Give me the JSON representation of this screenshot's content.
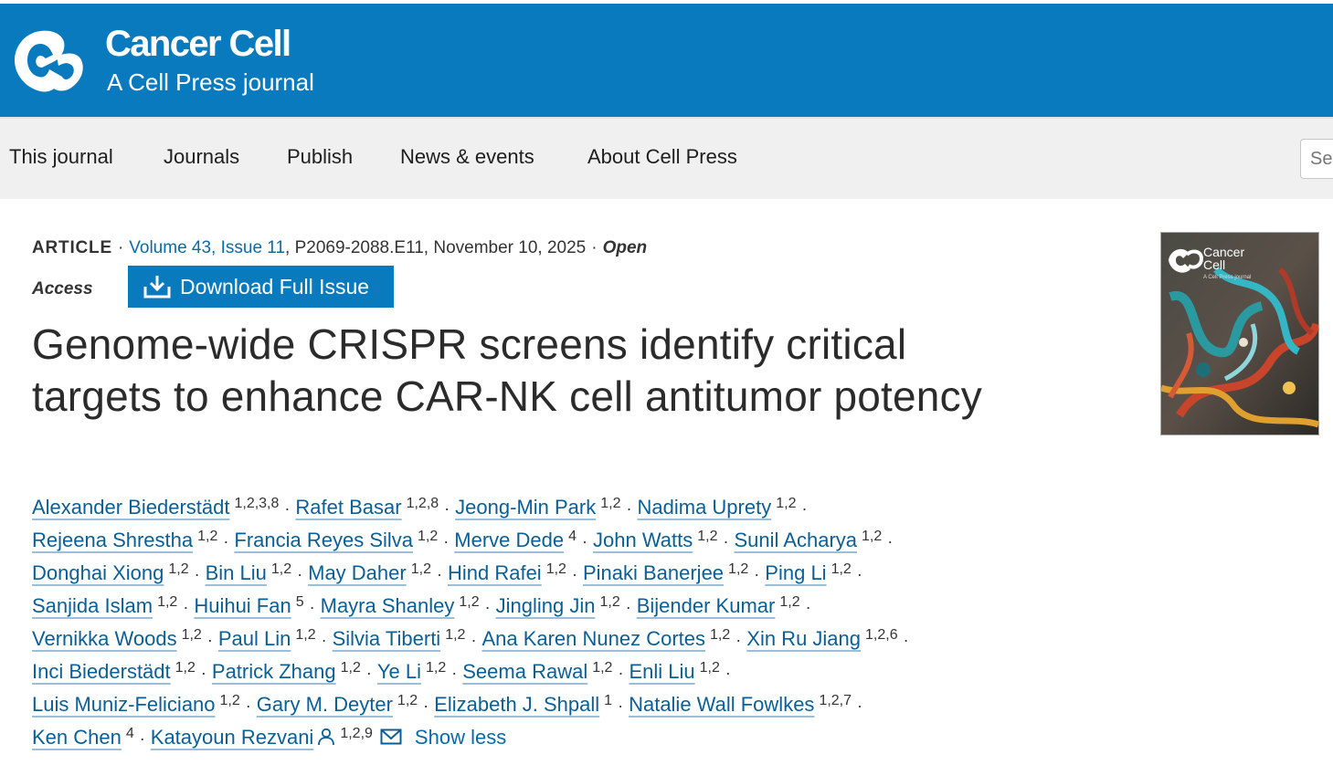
{
  "header": {
    "journal_name": "Cancer Cell",
    "subtitle": "A Cell Press journal",
    "logo_icon": "cell-press-logo-icon"
  },
  "nav": {
    "items": [
      {
        "label": "This journal"
      },
      {
        "label": "Journals"
      },
      {
        "label": "Publish"
      },
      {
        "label": "News & events"
      },
      {
        "label": "About Cell Press"
      }
    ],
    "search_placeholder": "Se"
  },
  "article": {
    "type": "ARTICLE",
    "volume_issue": "Volume 43, Issue 11",
    "pages_date": "P2069-2088.E11, November 10, 2025",
    "open_access_1": "Open",
    "open_access_2": "Access",
    "download_label": "Download Full Issue",
    "title": "Genome-wide CRISPR screens identify critical targets to enhance CAR-NK cell antitumor potency",
    "show_less": "Show less"
  },
  "authors": [
    [
      [
        "Alexander Biederstädt",
        "1,2,3,8"
      ],
      [
        "Rafet Basar",
        "1,2,8"
      ],
      [
        "Jeong-Min Park",
        "1,2"
      ],
      [
        "Nadima Uprety",
        "1,2"
      ]
    ],
    [
      [
        "Rejeena Shrestha",
        "1,2"
      ],
      [
        "Francia Reyes Silva",
        "1,2"
      ],
      [
        "Merve Dede",
        "4"
      ],
      [
        "John Watts",
        "1,2"
      ],
      [
        "Sunil Acharya",
        "1,2"
      ]
    ],
    [
      [
        "Donghai Xiong",
        "1,2"
      ],
      [
        "Bin Liu",
        "1,2"
      ],
      [
        "May Daher",
        "1,2"
      ],
      [
        "Hind Rafei",
        "1,2"
      ],
      [
        "Pinaki Banerjee",
        "1,2"
      ],
      [
        "Ping Li",
        "1,2"
      ]
    ],
    [
      [
        "Sanjida Islam",
        "1,2"
      ],
      [
        "Huihui Fan",
        "5"
      ],
      [
        "Mayra Shanley",
        "1,2"
      ],
      [
        "Jingling Jin",
        "1,2"
      ],
      [
        "Bijender Kumar",
        "1,2"
      ]
    ],
    [
      [
        "Vernikka Woods",
        "1,2"
      ],
      [
        "Paul Lin",
        "1,2"
      ],
      [
        "Silvia Tiberti",
        "1,2"
      ],
      [
        "Ana Karen Nunez Cortes",
        "1,2"
      ],
      [
        "Xin Ru Jiang",
        "1,2,6"
      ]
    ],
    [
      [
        "Inci Biederstädt",
        "1,2"
      ],
      [
        "Patrick Zhang",
        "1,2"
      ],
      [
        "Ye Li",
        "1,2"
      ],
      [
        "Seema Rawal",
        "1,2"
      ],
      [
        "Enli Liu",
        "1,2"
      ]
    ],
    [
      [
        "Luis Muniz-Feliciano",
        "1,2"
      ],
      [
        "Gary M. Deyter",
        "1,2"
      ],
      [
        "Elizabeth J. Shpall",
        "1"
      ],
      [
        "Natalie Wall Fowlkes",
        "1,2,7"
      ]
    ],
    [
      [
        "Ken Chen",
        "4"
      ],
      [
        "Katayoun Rezvani",
        "1,2,9"
      ]
    ]
  ],
  "cover": {
    "title_line1": "Cancer",
    "title_line2": "Cell",
    "subtitle": "A Cell Press journal"
  },
  "colors": {
    "brand": "#0a7abf",
    "link": "#0a5f96",
    "nav_bg": "#f0f0f0"
  }
}
